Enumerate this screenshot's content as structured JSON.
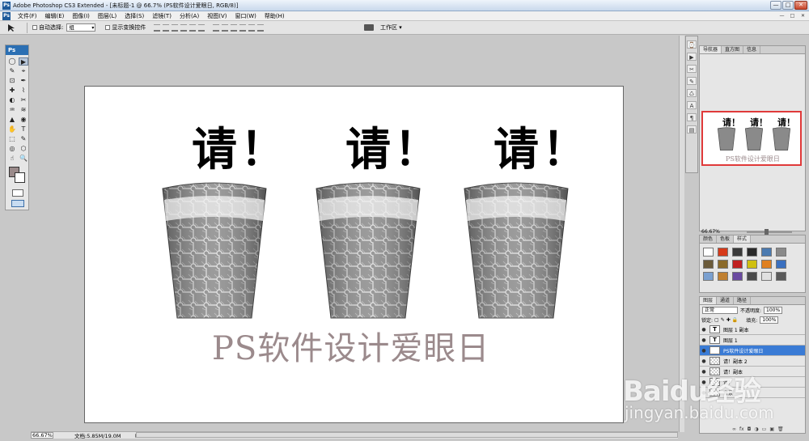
{
  "window": {
    "title": "Adobe Photoshop CS3 Extended - [未标题-1 @ 66.7% (PS软件设计爱眼日, RGB/8)]",
    "app_badge": "Ps",
    "buttons": {
      "minimize": "—",
      "maximize": "□",
      "close": "✕"
    }
  },
  "menubar": {
    "items": [
      "文件(F)",
      "编辑(E)",
      "图像(I)",
      "图层(L)",
      "选择(S)",
      "滤镜(T)",
      "分析(A)",
      "视图(V)",
      "窗口(W)",
      "帮助(H)"
    ]
  },
  "options": {
    "auto_select": "自动选择:",
    "auto_select_value": "组",
    "show_transform": "显示变换控件",
    "workspace": "工作区 ▾"
  },
  "toolbox": {
    "logo": "Ps",
    "tools": [
      "◯",
      "▶",
      "✎",
      "⌖",
      "⊡",
      "✒",
      "✚",
      "⌇",
      "◐",
      "✂",
      "♒",
      "≋",
      "▲",
      "◉",
      "✋",
      "T",
      "⬚",
      "✎",
      "◎",
      "⬡",
      "☝",
      "🔍"
    ]
  },
  "canvas": {
    "headline": "请！",
    "caption": "PS软件设计爱眼日",
    "colors": {
      "caption": "#9b8a8c",
      "background": "#ffffff"
    }
  },
  "status": {
    "zoom": "66.67%",
    "doc": "文档:5.85M/19.0M"
  },
  "navigator": {
    "tabs": [
      "导航器",
      "直方图",
      "信息"
    ],
    "zoom": "66.67%",
    "thumb_caption": "PS软件设计爱眼日",
    "thumb_headline": "请！"
  },
  "styles": {
    "tabs": [
      "颜色",
      "色板",
      "样式"
    ],
    "swatches": [
      "#ffffff",
      "#d63a1a",
      "#3a3a3a",
      "#2a2a2a",
      "#4a7ab0",
      "#8a8a8a",
      "#6a5a3a",
      "#8a6a2a",
      "#c02020",
      "#d0c010",
      "#e08020",
      "#3a70c0",
      "#7aa0d0",
      "#c08030",
      "#6a4aa0",
      "#4a4a4a",
      "#e0e0e0",
      "#5a5a5a"
    ]
  },
  "layers": {
    "tabs": [
      "图层",
      "通道",
      "路径"
    ],
    "blend_mode": "正常",
    "opacity_label": "不透明度:",
    "opacity": "100%",
    "lock_label": "锁定:",
    "fill_label": "填充:",
    "fill": "100%",
    "rows": [
      {
        "name": "图层 1 副本",
        "type": "T",
        "selected": false
      },
      {
        "name": "图层 1",
        "type": "T",
        "selected": false
      },
      {
        "name": "PS软件设计爱眼日",
        "type": "T",
        "selected": true
      },
      {
        "name": "请！副本 2",
        "type": "img",
        "selected": false
      },
      {
        "name": "请！副本",
        "type": "img",
        "selected": false
      },
      {
        "name": "请！",
        "type": "img",
        "selected": false
      },
      {
        "name": "背景",
        "type": "img",
        "selected": false
      }
    ]
  },
  "watermark": {
    "text": "Baidu经验",
    "sub": "jingyan.baidu.com"
  }
}
